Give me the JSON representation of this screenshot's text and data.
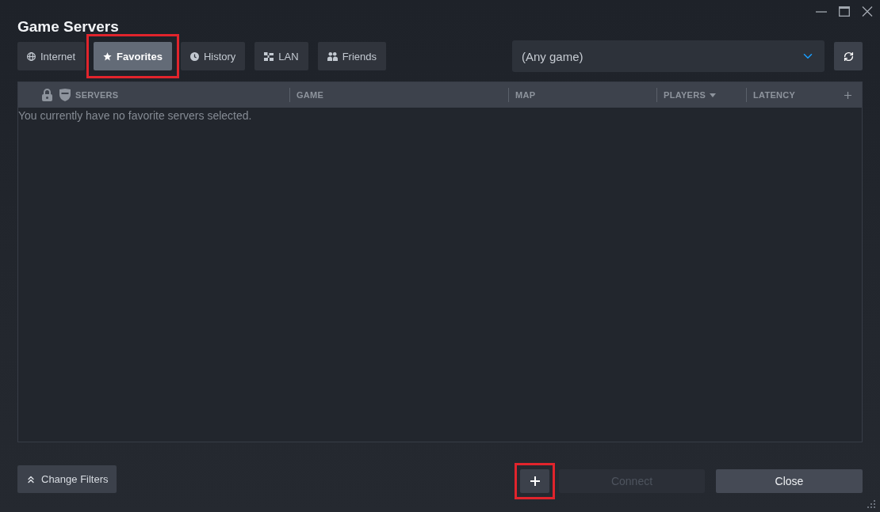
{
  "window": {
    "title": "Game Servers"
  },
  "tabs": [
    {
      "label": "Internet",
      "selected": false,
      "highlighted": false
    },
    {
      "label": "Favorites",
      "selected": true,
      "highlighted": true
    },
    {
      "label": "History",
      "selected": false,
      "highlighted": false
    },
    {
      "label": "LAN",
      "selected": false,
      "highlighted": false
    },
    {
      "label": "Friends",
      "selected": false,
      "highlighted": false
    }
  ],
  "game_filter": {
    "value": "(Any game)"
  },
  "server_list": {
    "columns": [
      {
        "label": "SERVERS",
        "sorted": false
      },
      {
        "label": "GAME",
        "sorted": false
      },
      {
        "label": "MAP",
        "sorted": false
      },
      {
        "label": "PLAYERS",
        "sorted": true
      },
      {
        "label": "LATENCY",
        "sorted": false
      }
    ],
    "empty_message": "You currently have no favorite servers selected."
  },
  "footer": {
    "change_filters": {
      "label": "Change Filters"
    },
    "add_server": {
      "highlighted": true
    },
    "connect": {
      "label": "Connect",
      "disabled": true
    },
    "close": {
      "label": "Close",
      "disabled": false
    }
  }
}
